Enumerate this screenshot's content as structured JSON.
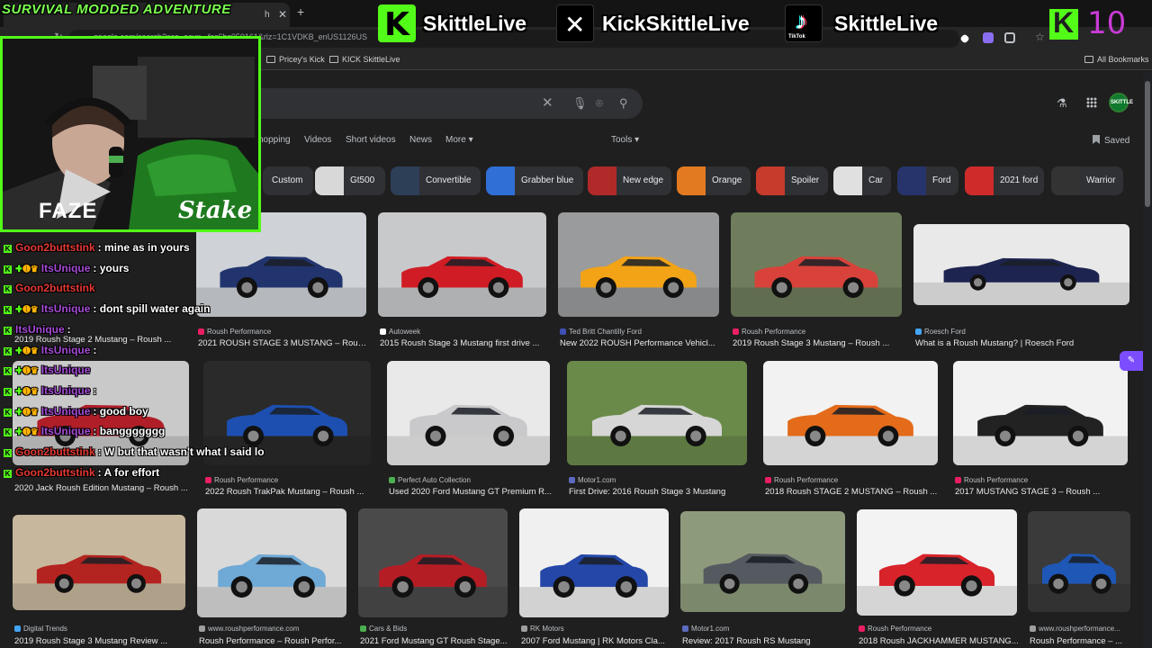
{
  "overlay": {
    "title": "SURVIVAL MODDED ADVENTURE",
    "socials": [
      {
        "platform": "kick-icon",
        "handle": "SkittleLive"
      },
      {
        "platform": "x-icon",
        "handle": "KickSkittleLive"
      },
      {
        "platform": "tiktok-icon",
        "handle": "SkittleLive",
        "badge": "TikTok"
      }
    ],
    "viewer_count": "10",
    "webcam_name": "FAZE",
    "sponsor": "Stake"
  },
  "browser": {
    "tab_title": "h",
    "url": "google.com/search?sca_esv=...fcc6bc050161&rlz=1C1VDKB_enUS1126US",
    "bookmarks": [
      "Pricey's Kick",
      "KICK  SkittleLive"
    ],
    "all_bookmarks": "All Bookmarks"
  },
  "google": {
    "filters": [
      "hopping",
      "Videos",
      "Short videos",
      "News",
      "More",
      "Tools"
    ],
    "saved": "Saved",
    "profile_label": "SKITTLE",
    "chips": [
      {
        "label": "Custom",
        "color": "#3a3a3a"
      },
      {
        "label": "Gt500",
        "color": "#d8d8d8"
      },
      {
        "label": "Convertible",
        "color": "#2d3e57"
      },
      {
        "label": "Grabber blue",
        "color": "#2f6fd6"
      },
      {
        "label": "New edge",
        "color": "#b02a2a"
      },
      {
        "label": "Orange",
        "color": "#e27a22"
      },
      {
        "label": "Spoiler",
        "color": "#c63b2b"
      },
      {
        "label": "Car",
        "color": "#e0e0e0"
      },
      {
        "label": "Ford",
        "color": "#27346b"
      },
      {
        "label": "2021 ford",
        "color": "#cf2b2b"
      },
      {
        "label": "Warrior",
        "color": "#333"
      }
    ],
    "results": [
      {
        "source": "Roush Performance",
        "title": "2021 ROUSH STAGE 3 MUSTANG – Roush ...",
        "car": "#21346e",
        "bg": "#cfd2d6"
      },
      {
        "source": "Autoweek",
        "title": "2015 Roush Stage 3 Mustang first drive ...",
        "car": "#d01c24",
        "bg": "#c8c9cb"
      },
      {
        "source": "Ted Britt Chantilly Ford",
        "title": "New 2022 ROUSH Performance Vehicl...",
        "car": "#f2a316",
        "bg": "#9a9b9d"
      },
      {
        "source": "Roush Performance",
        "title": "2019 Roush Stage 3 Mustang – Roush ...",
        "car": "#d8423a",
        "bg": "#6f7d5c"
      },
      {
        "source": "Roesch Ford",
        "title": "What is a Roush Mustang? | Roesch Ford",
        "car": "#1e2450",
        "bg": "#e9e9e9"
      },
      {
        "source": "",
        "title": "2019 Roush Stage 2 Mustang – Roush ...",
        "car": "#b01e28",
        "bg": "#c9c9c9"
      },
      {
        "source": "Roush Performance",
        "title": "2022 Roush TrakPak Mustang – Roush ...",
        "car": "#1d4fb0",
        "bg": "#2a2a2a"
      },
      {
        "source": "Perfect Auto Collection",
        "title": "Used 2020 Ford Mustang GT Premium R...",
        "car": "#c9c9cb",
        "bg": "#e9e9e9"
      },
      {
        "source": "Motor1.com",
        "title": "First Drive: 2016 Roush Stage 3 Mustang",
        "car": "#d6d6d6",
        "bg": "#6a8a4a"
      },
      {
        "source": "Roush Performance",
        "title": "2018 Roush STAGE 2 MUSTANG – Roush ...",
        "car": "#e36b1a",
        "bg": "#f2f2f2"
      },
      {
        "source": "Roush Performance",
        "title": "2017 MUSTANG STAGE 3 – Roush ...",
        "car": "#222",
        "bg": "#f2f2f2"
      },
      {
        "source": "",
        "title": "2020 Jack Roush Edition Mustang – Roush ...",
        "car": "#a81c22",
        "bg": "#ececec"
      },
      {
        "source": "Digital Trends",
        "title": "2019 Roush Stage 3 Mustang Review ...",
        "car": "#b3231f",
        "bg": "#c7b79c"
      },
      {
        "source": "www.roushperformance.com",
        "title": "Roush Performance – Roush Perfor...",
        "car": "#6fa9d6",
        "bg": "#d9d9d9"
      },
      {
        "source": "Cars & Bids",
        "title": "2021 Ford Mustang GT Roush Stage...",
        "car": "#b51d25",
        "bg": "#4a4a4a"
      },
      {
        "source": "RK Motors",
        "title": "2007 Ford Mustang | RK Motors Cla...",
        "car": "#2447a8",
        "bg": "#f0f0f0"
      },
      {
        "source": "Motor1.com",
        "title": "Review: 2017 Roush RS Mustang",
        "car": "#555a60",
        "bg": "#8d9b7c"
      },
      {
        "source": "Roush Performance",
        "title": "2018 Roush JACKHAMMER MUSTANG...",
        "car": "#d8232a",
        "bg": "#f3f3f3"
      },
      {
        "source": "www.roushperformance...",
        "title": "Roush Performance – ...",
        "car": "#1f57b6",
        "bg": "#3a3a3a"
      }
    ]
  },
  "chat": [
    {
      "user": "Goon2buttstink",
      "color": "#e53935",
      "badges": "",
      "msg": ": mine as in yours"
    },
    {
      "user": "ItsUnique",
      "color": "#a54bd6",
      "badges": "yes",
      "msg": ": yours"
    },
    {
      "user": "Goon2buttstink",
      "color": "#e53935",
      "badges": "",
      "msg": ""
    },
    {
      "user": "ItsUnique",
      "color": "#a54bd6",
      "badges": "yes",
      "msg": ": dont spill water again"
    },
    {
      "user": "ItsUnique",
      "color": "#a54bd6",
      "badges": "",
      "msg": ":"
    },
    {
      "user": "ItsUnique",
      "color": "#a54bd6",
      "badges": "yes",
      "msg": ":"
    },
    {
      "user": "ItsUnique",
      "color": "#a54bd6",
      "badges": "yes",
      "msg": ""
    },
    {
      "user": "ItsUnique",
      "color": "#a54bd6",
      "badges": "yes",
      "msg": ":"
    },
    {
      "user": "ItsUnique",
      "color": "#a54bd6",
      "badges": "yes",
      "msg": ": good boy"
    },
    {
      "user": "ItsUnique",
      "color": "#a54bd6",
      "badges": "yes",
      "msg": ": banggggggg"
    },
    {
      "user": "Goon2buttstink",
      "color": "#e53935",
      "badges": "",
      "msg": ": W but that wasn't what I said lo"
    },
    {
      "user": "Goon2buttstink",
      "color": "#e53935",
      "badges": "",
      "msg": ": A for effort"
    }
  ]
}
